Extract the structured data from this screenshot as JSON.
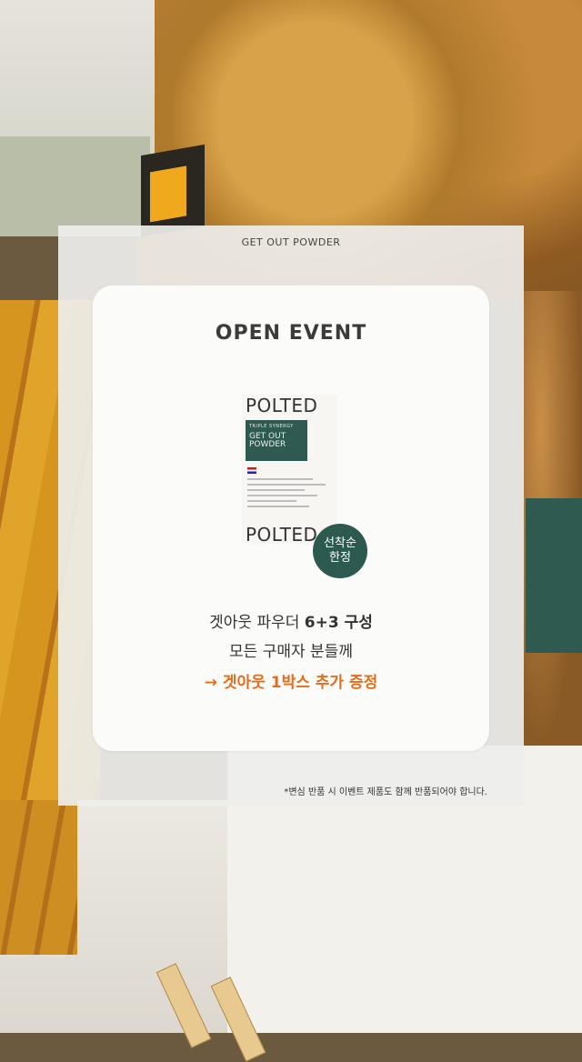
{
  "brand": "GET OUT POWDER",
  "card": {
    "title": "OPEN EVENT",
    "badge": "선착순\n한정",
    "line1_prefix": "겟아웃 파우더 ",
    "line1_bold": "6+3 구성",
    "line2": "모든 구매자 분들께",
    "line3": "→ 겟아웃 1박스 추가 증정"
  },
  "product": {
    "brand": "POLTED",
    "brand_bottom": "POLTED",
    "label_small": "TRIPLE SYNERGY",
    "label_big": "GET OUT POWDER"
  },
  "footnote": "*변심 반품 시 이벤트 제품도 함께 반품되어야 합니다.",
  "colors": {
    "accent": "#e46d1a",
    "badge": "#2d5a50",
    "panel": "#eeeeec",
    "card": "#fbfbfa"
  }
}
